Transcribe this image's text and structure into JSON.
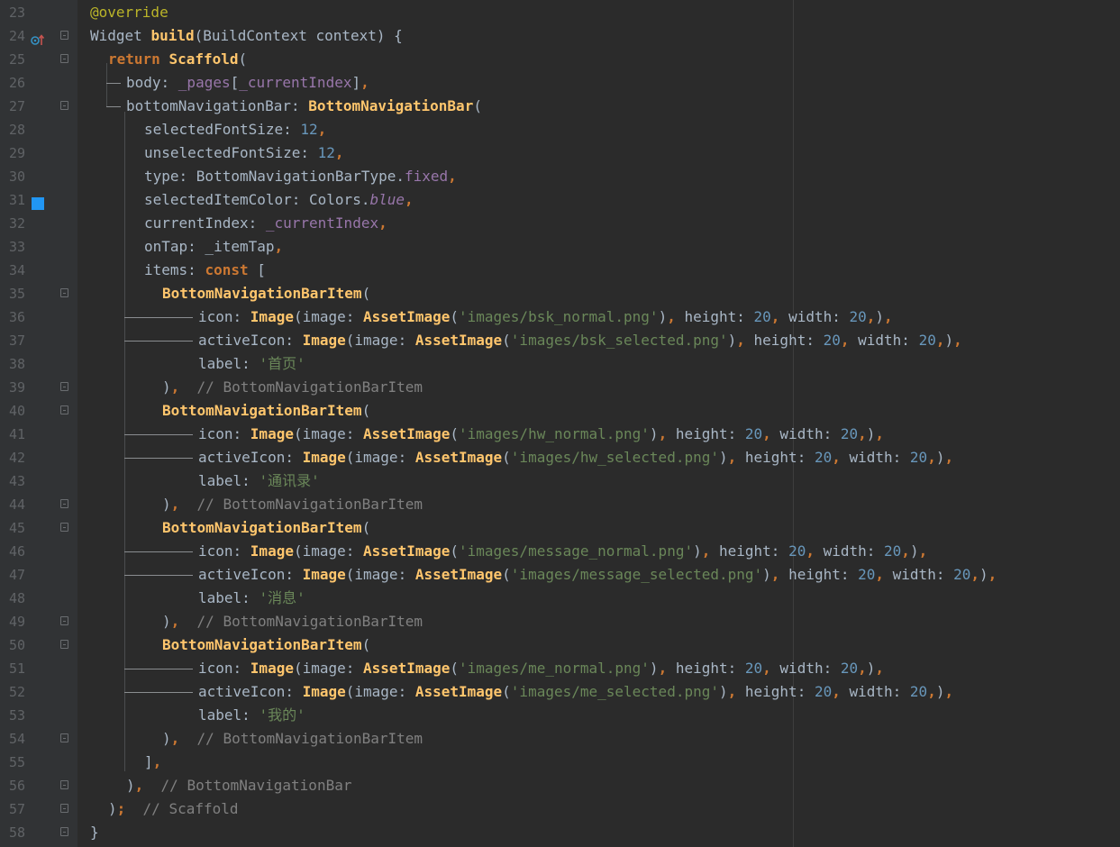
{
  "editor": {
    "swatch_color": "#2196f3",
    "lines": [
      {
        "n": "23",
        "segs": [
          [
            "an",
            "@override"
          ]
        ]
      },
      {
        "n": "24",
        "segs": [
          [
            "pl",
            "Widget "
          ],
          [
            "fn",
            "build"
          ],
          [
            "pl",
            "(BuildContext context) {"
          ]
        ]
      },
      {
        "n": "25",
        "segs": [
          [
            "kw",
            "return "
          ],
          [
            "fn",
            "Scaffold"
          ],
          [
            "pl",
            "("
          ]
        ]
      },
      {
        "n": "26",
        "segs": [
          [
            "pl",
            "body: "
          ],
          [
            "fd",
            "_pages"
          ],
          [
            "pl",
            "["
          ],
          [
            "fd",
            "_currentIndex"
          ],
          [
            "pl",
            "]"
          ],
          [
            "kw",
            ","
          ]
        ]
      },
      {
        "n": "27",
        "segs": [
          [
            "pl",
            "bottomNavigationBar: "
          ],
          [
            "fn",
            "BottomNavigationBar"
          ],
          [
            "pl",
            "("
          ]
        ]
      },
      {
        "n": "28",
        "segs": [
          [
            "pl",
            "selectedFontSize: "
          ],
          [
            "num",
            "12"
          ],
          [
            "kw",
            ","
          ]
        ]
      },
      {
        "n": "29",
        "segs": [
          [
            "pl",
            "unselectedFontSize: "
          ],
          [
            "num",
            "12"
          ],
          [
            "kw",
            ","
          ]
        ]
      },
      {
        "n": "30",
        "segs": [
          [
            "pl",
            "type: BottomNavigationBarType."
          ],
          [
            "fd",
            "fixed"
          ],
          [
            "kw",
            ","
          ]
        ]
      },
      {
        "n": "31",
        "segs": [
          [
            "pl",
            "selectedItemColor: Colors."
          ],
          [
            "fdi",
            "blue"
          ],
          [
            "kw",
            ","
          ]
        ]
      },
      {
        "n": "32",
        "segs": [
          [
            "pl",
            "currentIndex: "
          ],
          [
            "fd",
            "_currentIndex"
          ],
          [
            "kw",
            ","
          ]
        ]
      },
      {
        "n": "33",
        "segs": [
          [
            "pl",
            "onTap: _itemTap"
          ],
          [
            "kw",
            ","
          ]
        ]
      },
      {
        "n": "34",
        "segs": [
          [
            "pl",
            "items: "
          ],
          [
            "kw",
            "const "
          ],
          [
            "pl",
            "["
          ]
        ]
      },
      {
        "n": "35",
        "segs": [
          [
            "fn",
            "BottomNavigationBarItem"
          ],
          [
            "pl",
            "("
          ]
        ]
      },
      {
        "n": "36",
        "segs": [
          [
            "pl",
            "icon: "
          ],
          [
            "fn",
            "Image"
          ],
          [
            "pl",
            "(image: "
          ],
          [
            "fn",
            "AssetImage"
          ],
          [
            "pl",
            "("
          ],
          [
            "str",
            "'images/bsk_normal.png'"
          ],
          [
            "pl",
            ")"
          ],
          [
            "kw",
            ", "
          ],
          [
            "pl",
            "height: "
          ],
          [
            "num",
            "20"
          ],
          [
            "kw",
            ", "
          ],
          [
            "pl",
            "width: "
          ],
          [
            "num",
            "20"
          ],
          [
            "kw",
            ","
          ],
          [
            "pl",
            ")"
          ],
          [
            "kw",
            ","
          ]
        ]
      },
      {
        "n": "37",
        "segs": [
          [
            "pl",
            "activeIcon: "
          ],
          [
            "fn",
            "Image"
          ],
          [
            "pl",
            "(image: "
          ],
          [
            "fn",
            "AssetImage"
          ],
          [
            "pl",
            "("
          ],
          [
            "str",
            "'images/bsk_selected.png'"
          ],
          [
            "pl",
            ")"
          ],
          [
            "kw",
            ", "
          ],
          [
            "pl",
            "height: "
          ],
          [
            "num",
            "20"
          ],
          [
            "kw",
            ", "
          ],
          [
            "pl",
            "width: "
          ],
          [
            "num",
            "20"
          ],
          [
            "kw",
            ","
          ],
          [
            "pl",
            ")"
          ],
          [
            "kw",
            ","
          ]
        ]
      },
      {
        "n": "38",
        "segs": [
          [
            "pl",
            "label: "
          ],
          [
            "str",
            "'首页'"
          ]
        ]
      },
      {
        "n": "39",
        "segs": [
          [
            "pl",
            ")"
          ],
          [
            "kw",
            ",  "
          ],
          [
            "cm",
            "// BottomNavigationBarItem"
          ]
        ]
      },
      {
        "n": "40",
        "segs": [
          [
            "fn",
            "BottomNavigationBarItem"
          ],
          [
            "pl",
            "("
          ]
        ]
      },
      {
        "n": "41",
        "segs": [
          [
            "pl",
            "icon: "
          ],
          [
            "fn",
            "Image"
          ],
          [
            "pl",
            "(image: "
          ],
          [
            "fn",
            "AssetImage"
          ],
          [
            "pl",
            "("
          ],
          [
            "str",
            "'images/hw_normal.png'"
          ],
          [
            "pl",
            ")"
          ],
          [
            "kw",
            ", "
          ],
          [
            "pl",
            "height: "
          ],
          [
            "num",
            "20"
          ],
          [
            "kw",
            ", "
          ],
          [
            "pl",
            "width: "
          ],
          [
            "num",
            "20"
          ],
          [
            "kw",
            ","
          ],
          [
            "pl",
            ")"
          ],
          [
            "kw",
            ","
          ]
        ]
      },
      {
        "n": "42",
        "segs": [
          [
            "pl",
            "activeIcon: "
          ],
          [
            "fn",
            "Image"
          ],
          [
            "pl",
            "(image: "
          ],
          [
            "fn",
            "AssetImage"
          ],
          [
            "pl",
            "("
          ],
          [
            "str",
            "'images/hw_selected.png'"
          ],
          [
            "pl",
            ")"
          ],
          [
            "kw",
            ", "
          ],
          [
            "pl",
            "height: "
          ],
          [
            "num",
            "20"
          ],
          [
            "kw",
            ", "
          ],
          [
            "pl",
            "width: "
          ],
          [
            "num",
            "20"
          ],
          [
            "kw",
            ","
          ],
          [
            "pl",
            ")"
          ],
          [
            "kw",
            ","
          ]
        ]
      },
      {
        "n": "43",
        "segs": [
          [
            "pl",
            "label: "
          ],
          [
            "str",
            "'通讯录'"
          ]
        ]
      },
      {
        "n": "44",
        "segs": [
          [
            "pl",
            ")"
          ],
          [
            "kw",
            ",  "
          ],
          [
            "cm",
            "// BottomNavigationBarItem"
          ]
        ]
      },
      {
        "n": "45",
        "segs": [
          [
            "fn",
            "BottomNavigationBarItem"
          ],
          [
            "pl",
            "("
          ]
        ]
      },
      {
        "n": "46",
        "segs": [
          [
            "pl",
            "icon: "
          ],
          [
            "fn",
            "Image"
          ],
          [
            "pl",
            "(image: "
          ],
          [
            "fn",
            "AssetImage"
          ],
          [
            "pl",
            "("
          ],
          [
            "str",
            "'images/message_normal.png'"
          ],
          [
            "pl",
            ")"
          ],
          [
            "kw",
            ", "
          ],
          [
            "pl",
            "height: "
          ],
          [
            "num",
            "20"
          ],
          [
            "kw",
            ", "
          ],
          [
            "pl",
            "width: "
          ],
          [
            "num",
            "20"
          ],
          [
            "kw",
            ","
          ],
          [
            "pl",
            ")"
          ],
          [
            "kw",
            ","
          ]
        ]
      },
      {
        "n": "47",
        "segs": [
          [
            "pl",
            "activeIcon: "
          ],
          [
            "fn",
            "Image"
          ],
          [
            "pl",
            "(image: "
          ],
          [
            "fn",
            "AssetImage"
          ],
          [
            "pl",
            "("
          ],
          [
            "str",
            "'images/message_selected.png'"
          ],
          [
            "pl",
            ")"
          ],
          [
            "kw",
            ", "
          ],
          [
            "pl",
            "height: "
          ],
          [
            "num",
            "20"
          ],
          [
            "kw",
            ", "
          ],
          [
            "pl",
            "width: "
          ],
          [
            "num",
            "20"
          ],
          [
            "kw",
            ","
          ],
          [
            "pl",
            ")"
          ],
          [
            "kw",
            ","
          ]
        ]
      },
      {
        "n": "48",
        "segs": [
          [
            "pl",
            "label: "
          ],
          [
            "str",
            "'消息'"
          ]
        ]
      },
      {
        "n": "49",
        "segs": [
          [
            "pl",
            ")"
          ],
          [
            "kw",
            ",  "
          ],
          [
            "cm",
            "// BottomNavigationBarItem"
          ]
        ]
      },
      {
        "n": "50",
        "segs": [
          [
            "fn",
            "BottomNavigationBarItem"
          ],
          [
            "pl",
            "("
          ]
        ]
      },
      {
        "n": "51",
        "segs": [
          [
            "pl",
            "icon: "
          ],
          [
            "fn",
            "Image"
          ],
          [
            "pl",
            "(image: "
          ],
          [
            "fn",
            "AssetImage"
          ],
          [
            "pl",
            "("
          ],
          [
            "str",
            "'images/me_normal.png'"
          ],
          [
            "pl",
            ")"
          ],
          [
            "kw",
            ", "
          ],
          [
            "pl",
            "height: "
          ],
          [
            "num",
            "20"
          ],
          [
            "kw",
            ", "
          ],
          [
            "pl",
            "width: "
          ],
          [
            "num",
            "20"
          ],
          [
            "kw",
            ","
          ],
          [
            "pl",
            ")"
          ],
          [
            "kw",
            ","
          ]
        ]
      },
      {
        "n": "52",
        "segs": [
          [
            "pl",
            "activeIcon: "
          ],
          [
            "fn",
            "Image"
          ],
          [
            "pl",
            "(image: "
          ],
          [
            "fn",
            "AssetImage"
          ],
          [
            "pl",
            "("
          ],
          [
            "str",
            "'images/me_selected.png'"
          ],
          [
            "pl",
            ")"
          ],
          [
            "kw",
            ", "
          ],
          [
            "pl",
            "height: "
          ],
          [
            "num",
            "20"
          ],
          [
            "kw",
            ", "
          ],
          [
            "pl",
            "width: "
          ],
          [
            "num",
            "20"
          ],
          [
            "kw",
            ","
          ],
          [
            "pl",
            ")"
          ],
          [
            "kw",
            ","
          ]
        ]
      },
      {
        "n": "53",
        "segs": [
          [
            "pl",
            "label: "
          ],
          [
            "str",
            "'我的'"
          ]
        ]
      },
      {
        "n": "54",
        "segs": [
          [
            "pl",
            ")"
          ],
          [
            "kw",
            ",  "
          ],
          [
            "cm",
            "// BottomNavigationBarItem"
          ]
        ]
      },
      {
        "n": "55",
        "segs": [
          [
            "pl",
            "]"
          ],
          [
            "kw",
            ","
          ]
        ]
      },
      {
        "n": "56",
        "segs": [
          [
            "pl",
            ")"
          ],
          [
            "kw",
            ",  "
          ],
          [
            "cm",
            "// BottomNavigationBar"
          ]
        ]
      },
      {
        "n": "57",
        "segs": [
          [
            "pl",
            ")"
          ],
          [
            "kw",
            ";  "
          ],
          [
            "cm",
            "// Scaffold"
          ]
        ]
      },
      {
        "n": "58",
        "segs": [
          [
            "pl",
            "}"
          ]
        ]
      }
    ]
  }
}
